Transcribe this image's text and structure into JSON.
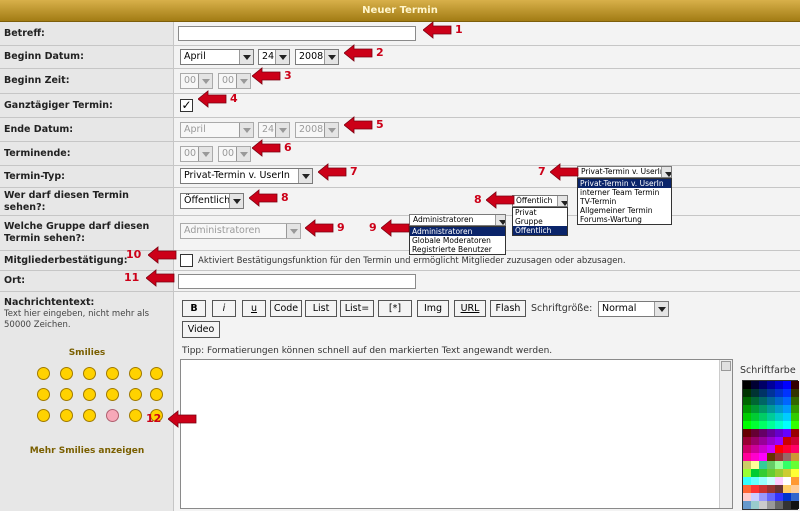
{
  "header": {
    "title": "Neuer Termin"
  },
  "labels": {
    "betreff": "Betreff:",
    "beginn_datum": "Beginn Datum:",
    "beginn_zeit": "Beginn Zeit:",
    "ganztaegig": "Ganztägiger Termin:",
    "ende_datum": "Ende Datum:",
    "terminende": "Terminende:",
    "termin_typ": "Termin-Typ:",
    "wer_darf": "Wer darf diesen Termin sehen?:",
    "welche_gruppe": "Welche Gruppe darf diesen Termin sehen?:",
    "mitgliederbestaetigung": "Mitgliederbestätigung:",
    "ort": "Ort:",
    "nachrichtentext": "Nachrichtentext:"
  },
  "nachricht_hint": "Text hier eingeben, nicht mehr als 50000 Zeichen.",
  "beginn": {
    "month": "April",
    "day": "24",
    "year": "2008",
    "hour": "00",
    "minute": "00"
  },
  "ende": {
    "month": "April",
    "day": "24",
    "year": "2008",
    "hour": "00",
    "minute": "00"
  },
  "termin_typ": {
    "selected": "Privat-Termin v. UserIn",
    "options": [
      "Privat-Termin v. UserIn",
      "interner Team Termin",
      "TV-Termin",
      "Allgemeiner Termin",
      "Forums-Wartung"
    ]
  },
  "sichtbar": {
    "selected": "Öffentlich",
    "options": [
      "Privat",
      "Gruppe",
      "Öffentlich"
    ]
  },
  "gruppe": {
    "selected": "Administratoren",
    "options": [
      "Administratoren",
      "Globale Moderatoren",
      "Registrierte Benutzer"
    ]
  },
  "bestaetigung_text": "Aktiviert Bestätigungsfunktion für den Termin und ermöglicht Mitglieder zuzusagen oder abzusagen.",
  "toolbar": {
    "buttons": [
      "B",
      "i",
      "u",
      "Code",
      "List",
      "List=",
      "[*]",
      "Img",
      "URL",
      "Flash"
    ],
    "video": "Video",
    "size_label": "Schriftgröße:",
    "size_value": "Normal"
  },
  "tipp": "Tipp: Formatierungen können schnell auf den markierten Text angewandt werden.",
  "smilies": {
    "title": "Smilies",
    "more": "Mehr Smilies anzeigen"
  },
  "schriftfarbe": "Schriftfarbe",
  "markers": [
    "1",
    "2",
    "3",
    "4",
    "5",
    "6",
    "7",
    "8",
    "9",
    "10",
    "11",
    "12",
    "7",
    "8",
    "9"
  ],
  "colors": {
    "header": "#a27c14",
    "arrow": "#cc0018",
    "smilies_title": "#7a5f00"
  }
}
